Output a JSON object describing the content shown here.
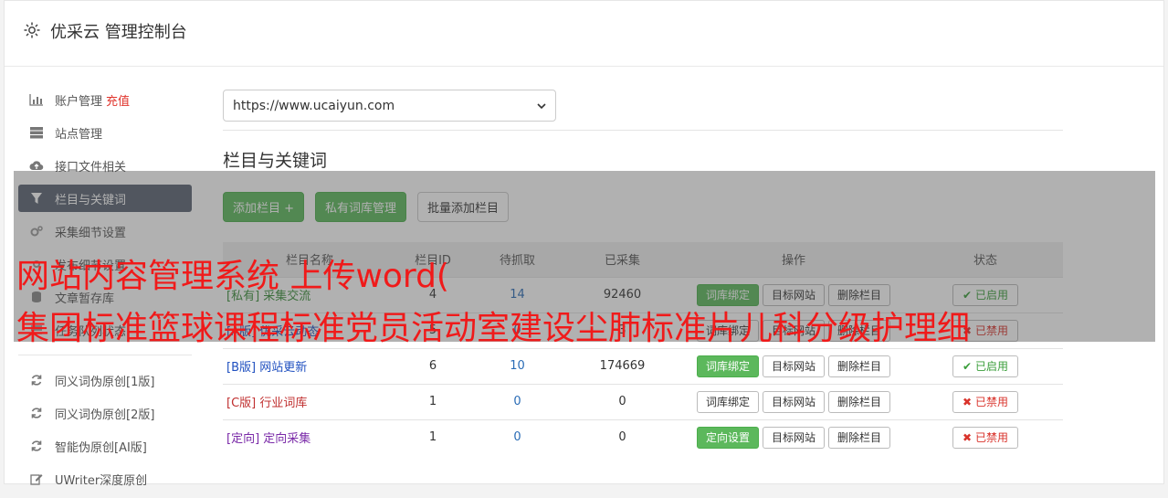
{
  "app": {
    "title": "优采云 管理控制台"
  },
  "sidebar": {
    "items": [
      {
        "label": "账户管理",
        "extra": "充值",
        "icon": "bar-chart-icon"
      },
      {
        "label": "站点管理",
        "icon": "server-icon"
      },
      {
        "label": "接口文件相关",
        "icon": "cloud-upload-icon"
      },
      {
        "label": "栏目与关键词",
        "icon": "filter-icon"
      },
      {
        "label": "采集细节设置",
        "icon": "cogs-icon"
      },
      {
        "label": "发布细节设置",
        "icon": "gear-icon"
      },
      {
        "label": "文章暂存库",
        "icon": "database-icon"
      },
      {
        "label": "任务队列状态",
        "icon": "list-icon"
      }
    ],
    "tools": [
      {
        "label": "同义词伪原创[1版]",
        "icon": "refresh-icon"
      },
      {
        "label": "同义词伪原创[2版]",
        "icon": "refresh-icon"
      },
      {
        "label": "智能伪原创[AI版]",
        "icon": "refresh-icon"
      },
      {
        "label": "UWriter深度原创",
        "icon": "edit-icon"
      }
    ]
  },
  "site_select": {
    "value": "https://www.ucaiyun.com"
  },
  "section": {
    "title": "栏目与关键词"
  },
  "toolbar": {
    "add_column": "添加栏目 +",
    "private_lib": "私有词库管理",
    "batch_add": "批量添加栏目"
  },
  "table": {
    "headers": [
      "栏目名称",
      "栏目ID",
      "待抓取",
      "已采集",
      "操作",
      "状态"
    ],
    "rows": [
      {
        "tag": "[私有]",
        "name": "采集交流",
        "tag_color": "green",
        "id": "4",
        "pending": "14",
        "collected": "92460",
        "op1": "词库绑定",
        "op1_green": true,
        "op2": "目标网站",
        "op3": "删除栏目",
        "status": "已启用",
        "on": true
      },
      {
        "tag": "[A版]",
        "name": "优采云动态",
        "tag_color": "blue",
        "id": "5",
        "pending": "0",
        "collected": "3",
        "op1": "词库绑定",
        "op1_green": false,
        "op2": "目标网站",
        "op3": "删除栏目",
        "status": "已禁用",
        "on": false
      },
      {
        "tag": "[B版]",
        "name": "网站更新",
        "tag_color": "blue",
        "id": "6",
        "pending": "10",
        "collected": "174669",
        "op1": "词库绑定",
        "op1_green": true,
        "op2": "目标网站",
        "op3": "删除栏目",
        "status": "已启用",
        "on": true
      },
      {
        "tag": "[C版]",
        "name": "行业词库",
        "tag_color": "red",
        "id": "1",
        "pending": "0",
        "collected": "0",
        "op1": "词库绑定",
        "op1_green": false,
        "op2": "目标网站",
        "op3": "删除栏目",
        "status": "已禁用",
        "on": false
      },
      {
        "tag": "[定向]",
        "name": "定向采集",
        "tag_color": "purple",
        "id": "1",
        "pending": "0",
        "collected": "0",
        "op1": "定向设置",
        "op1_green": true,
        "op2": "目标网站",
        "op3": "删除栏目",
        "status": "已禁用",
        "on": false
      }
    ]
  },
  "watermark": {
    "line1": "网站内容管理系统 上传word(",
    "line2": "集团标准篮球课程标准党员活动室建设尘肺标准片儿科分级护理细"
  }
}
